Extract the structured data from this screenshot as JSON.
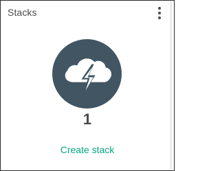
{
  "card": {
    "title": "Stacks",
    "count": "1",
    "create_label": "Create stack",
    "logo_icon": "cloud-lightning-icon",
    "menu_icon": "more-vertical-icon"
  },
  "colors": {
    "logo_circle": "#425563",
    "logo_symbol": "#ffffff",
    "link": "#01a982",
    "text": "#4a4a4a"
  }
}
